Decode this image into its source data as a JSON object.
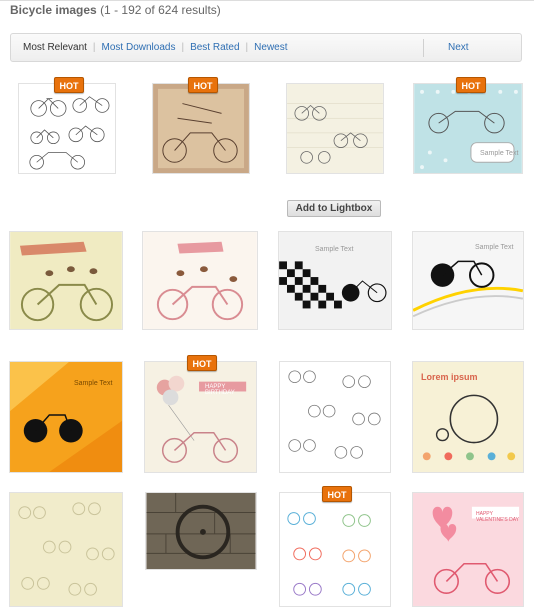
{
  "header": {
    "title": "Bicycle images",
    "count": "(1 - 192 of 624 results)"
  },
  "sort": {
    "active": "Most Relevant",
    "links": [
      "Most Downloads",
      "Best Rated",
      "Newest"
    ],
    "next": "Next"
  },
  "badge": "HOT",
  "lightbox_label": "Add to Lightbox",
  "tile_texts": {
    "sample_text": "Sample Text",
    "lorem": "Lorem ipsum",
    "birthday": "HAPPY BIRTHDAY",
    "valentine": "HAPPY VALENTINE'S DAY"
  },
  "colors": {
    "hot": "#e8720c",
    "link": "#2f6fb3"
  }
}
